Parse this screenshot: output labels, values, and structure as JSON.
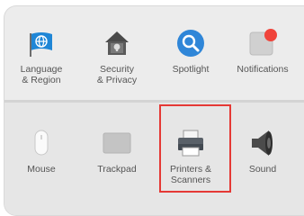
{
  "top_row": [
    {
      "id": "language-region",
      "label": "Language\n& Region",
      "icon": "flag-globe-icon"
    },
    {
      "id": "security-privacy",
      "label": "Security\n& Privacy",
      "icon": "house-lock-icon"
    },
    {
      "id": "spotlight",
      "label": "Spotlight",
      "icon": "magnifier-icon"
    },
    {
      "id": "notifications",
      "label": "Notifications",
      "icon": "notification-badge-icon"
    }
  ],
  "bottom_row": [
    {
      "id": "mouse",
      "label": "Mouse",
      "icon": "mouse-icon"
    },
    {
      "id": "trackpad",
      "label": "Trackpad",
      "icon": "trackpad-icon"
    },
    {
      "id": "printers-scanners",
      "label": "Printers &\nScanners",
      "icon": "printer-icon",
      "highlighted": true
    },
    {
      "id": "sound",
      "label": "Sound",
      "icon": "speaker-icon"
    }
  ],
  "colors": {
    "highlight": "#e53935",
    "spotlight_blue": "#2f86d8",
    "notification_red": "#f0433a"
  }
}
